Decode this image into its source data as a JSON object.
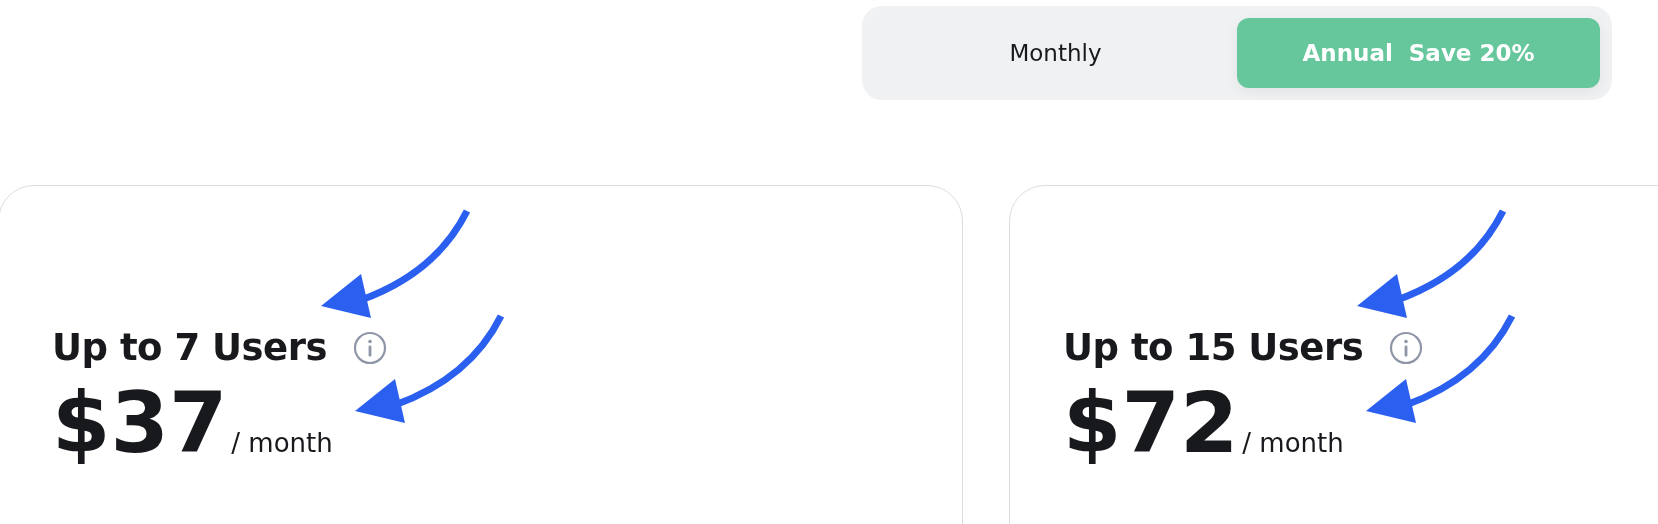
{
  "billing_toggle": [
    {
      "label": "Monthly",
      "selected": false
    },
    {
      "label": "Annual",
      "badge": "Save 20%",
      "selected": true
    }
  ],
  "plans": [
    {
      "title": "Up to 7 Users",
      "price": "$37",
      "period": "/ month"
    },
    {
      "title": "Up to 15 Users",
      "price": "$72",
      "period": "/ month"
    }
  ]
}
